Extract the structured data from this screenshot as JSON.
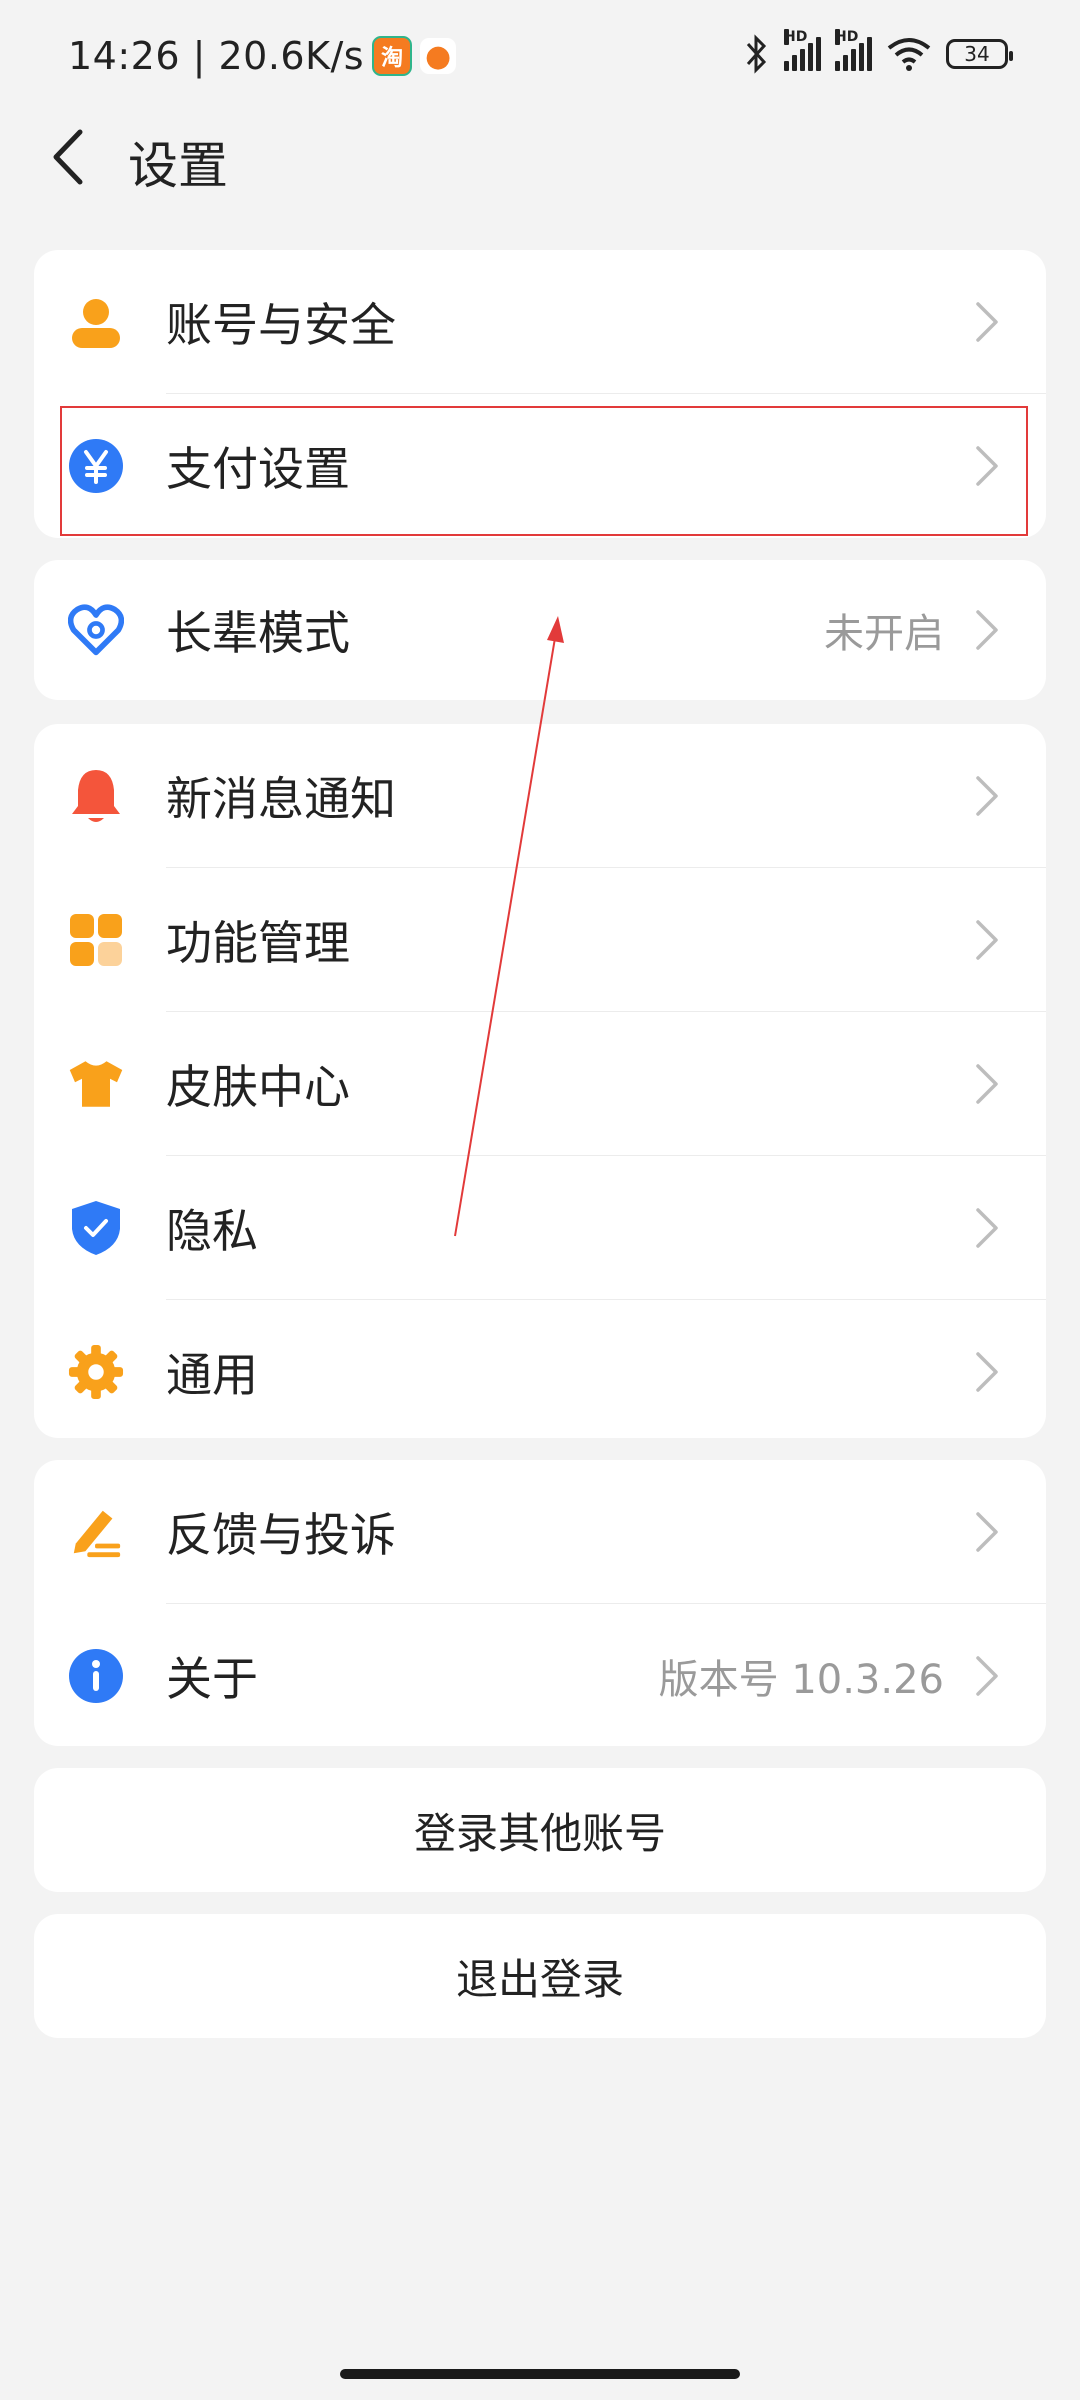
{
  "status_bar": {
    "time_speed": "14:26 | 20.6K/s",
    "taobao_badge": "淘",
    "battery": "34",
    "hd1": "HD",
    "hd2": "HD"
  },
  "header": {
    "title": "设置"
  },
  "groups": {
    "g1": {
      "account": {
        "label": "账号与安全",
        "icon": "person-icon"
      },
      "payment": {
        "label": "支付设置",
        "icon": "yuan-icon"
      }
    },
    "g2": {
      "elder": {
        "label": "长辈模式",
        "value": "未开启",
        "icon": "heart-icon"
      }
    },
    "g3": {
      "notify": {
        "label": "新消息通知",
        "icon": "bell-icon"
      },
      "features": {
        "label": "功能管理",
        "icon": "grid-icon"
      },
      "skin": {
        "label": "皮肤中心",
        "icon": "shirt-icon"
      },
      "privacy": {
        "label": "隐私",
        "icon": "shield-icon"
      },
      "general": {
        "label": "通用",
        "icon": "gear-icon"
      }
    },
    "g4": {
      "feedback": {
        "label": "反馈与投诉",
        "icon": "edit-icon"
      },
      "about": {
        "label": "关于",
        "value": "版本号 10.3.26",
        "icon": "info-icon"
      }
    }
  },
  "buttons": {
    "switch_account": "登录其他账号",
    "logout": "退出登录"
  },
  "colors": {
    "orange": "#f9a11b",
    "blue": "#2f7af6",
    "red": "#f4553b",
    "highlight": "#e23a3a"
  }
}
